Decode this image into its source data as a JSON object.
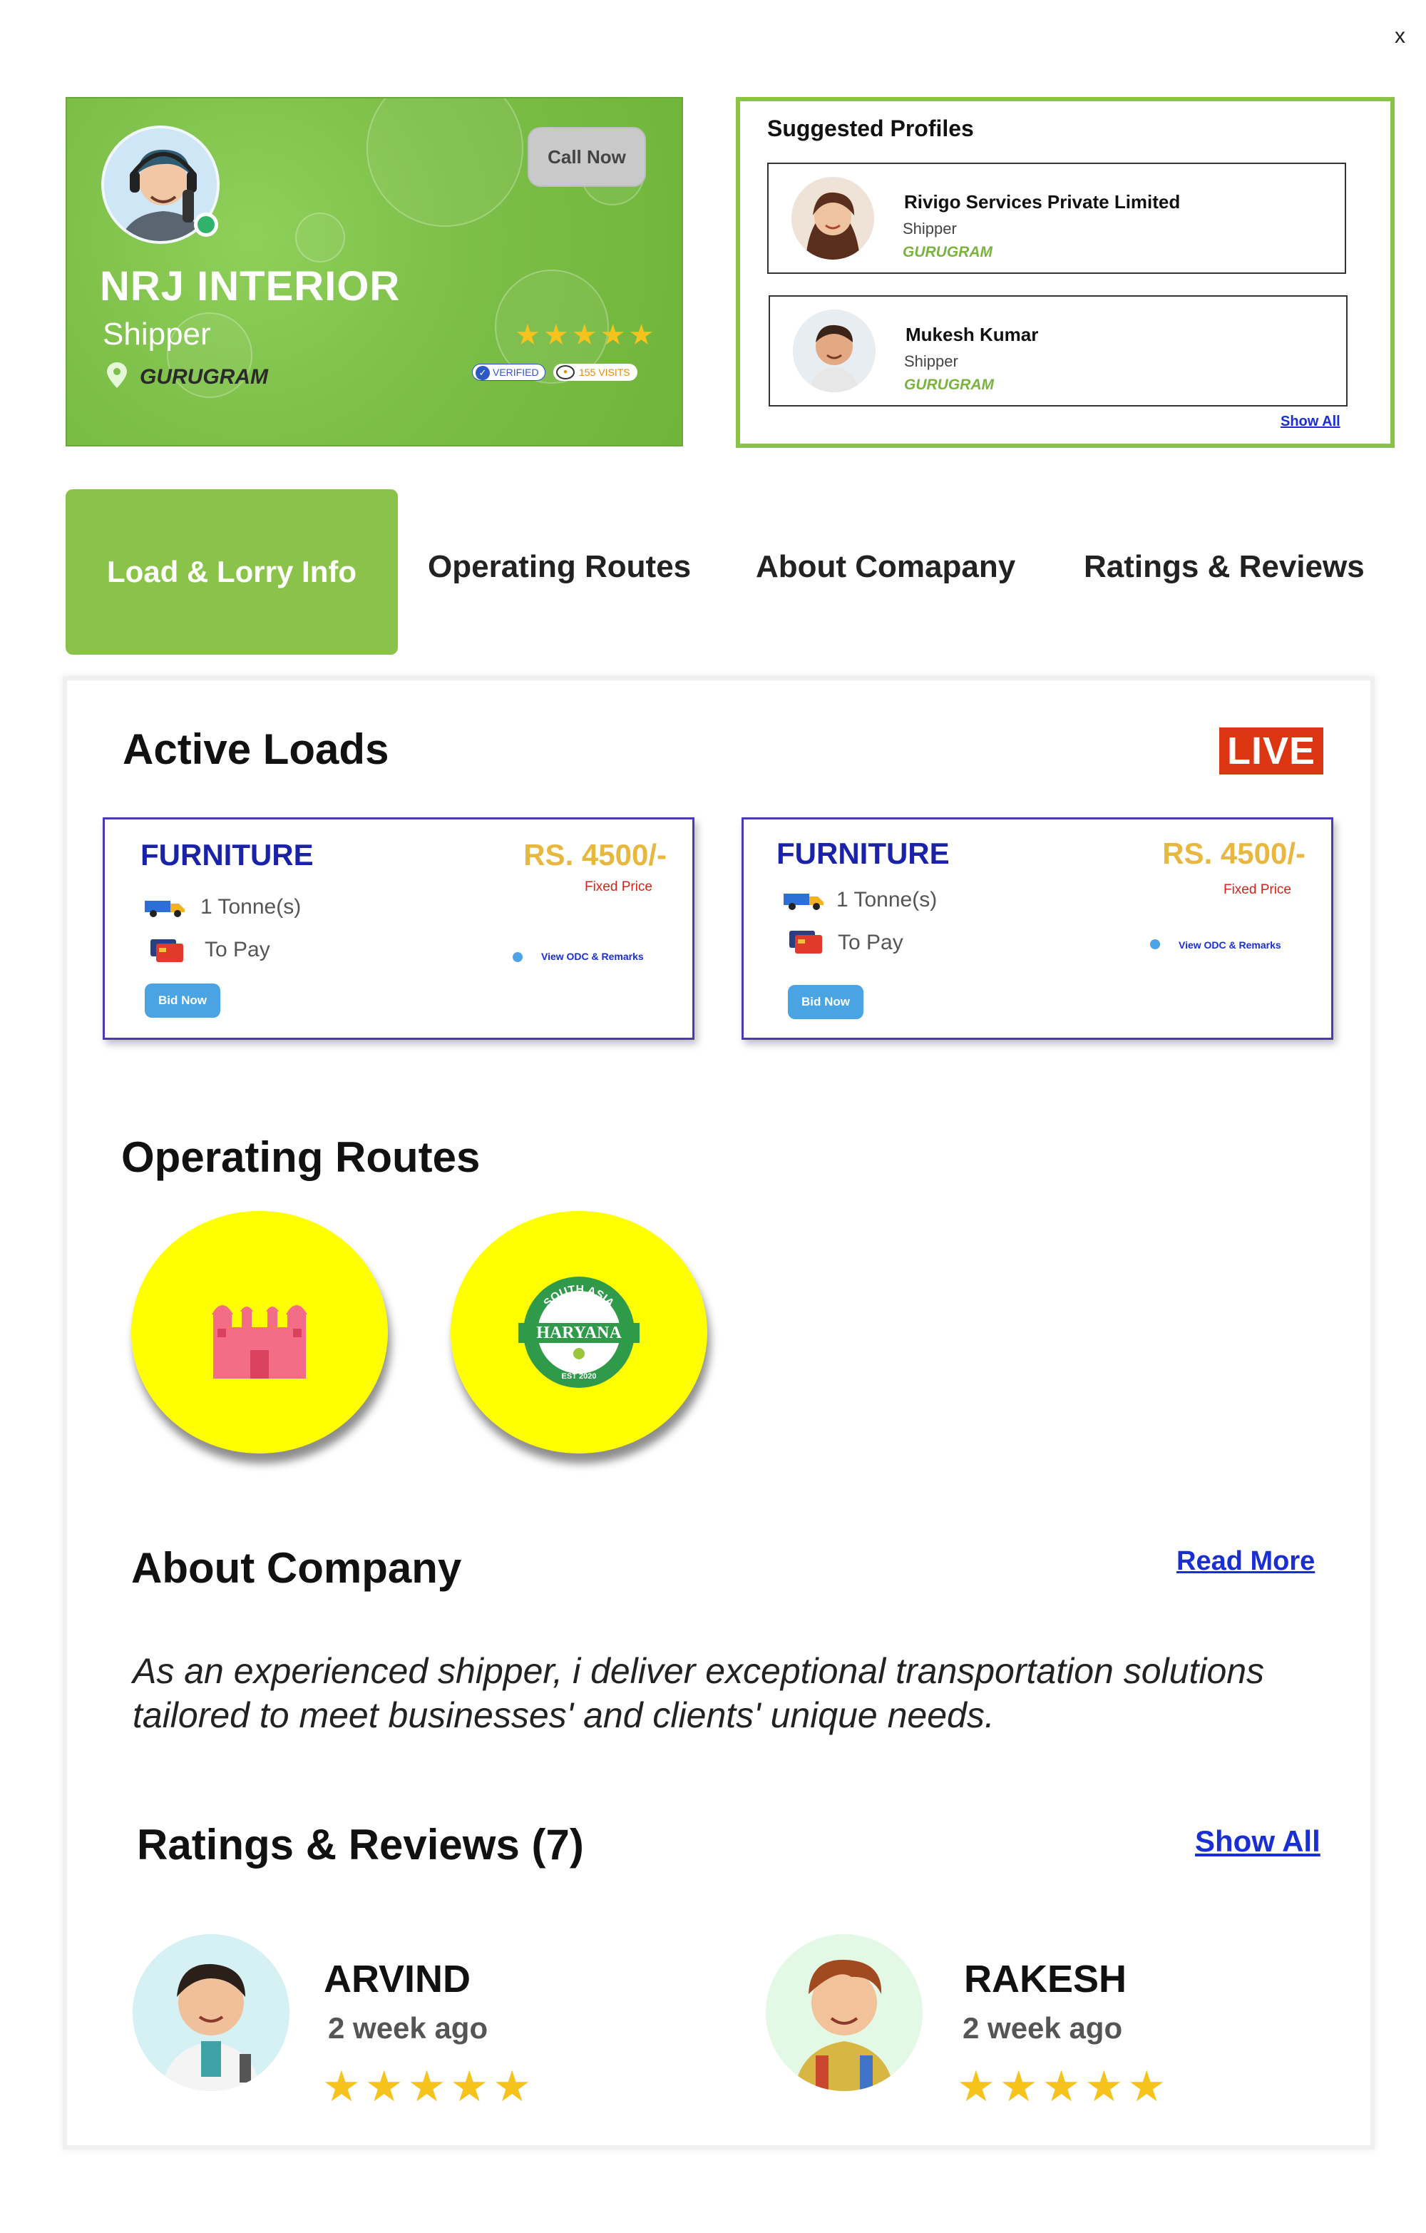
{
  "close_label": "x",
  "profile": {
    "name": "NRJ INTERIOR",
    "role": "Shipper",
    "city": "GURUGRAM",
    "call_label": "Call Now",
    "rating": 5,
    "verified_label": "VERIFIED",
    "visits_label": "155 VISITS"
  },
  "suggested": {
    "title": "Suggested Profiles",
    "items": [
      {
        "name": "Rivigo Services Private Limited",
        "role": "Shipper",
        "city": "GURUGRAM"
      },
      {
        "name": "Mukesh Kumar",
        "role": "Shipper",
        "city": "GURUGRAM"
      }
    ],
    "show_all": "Show All"
  },
  "tabs": [
    {
      "label": "Load & Lorry Info",
      "active": true
    },
    {
      "label": "Operating Routes",
      "active": false
    },
    {
      "label": "About Comapany",
      "active": false
    },
    {
      "label": "Ratings & Reviews",
      "active": false
    }
  ],
  "active_loads": {
    "title": "Active Loads",
    "live_label": "LIVE",
    "cards": [
      {
        "material": "FURNITURE",
        "price": "RS. 4500/-",
        "price_type": "Fixed Price",
        "weight": "1 Tonne(s)",
        "payment": "To Pay",
        "odc_link": "View ODC & Remarks",
        "bid_label": "Bid Now"
      },
      {
        "material": "FURNITURE",
        "price": "RS. 4500/-",
        "price_type": "Fixed Price",
        "weight": "1 Tonne(s)",
        "payment": "To Pay",
        "odc_link": "View ODC & Remarks",
        "bid_label": "Bid Now"
      }
    ]
  },
  "operating_routes": {
    "title": "Operating Routes",
    "routes": [
      {
        "icon": "red-fort-icon"
      },
      {
        "icon": "haryana-emblem-icon",
        "emblem_text": "HARYANA",
        "emblem_top": "SOUTH ASIA",
        "emblem_bottom": "EST 2020"
      }
    ]
  },
  "about": {
    "title": "About Company",
    "read_more": "Read More",
    "text": "As an experienced shipper, i deliver exceptional transportation solutions tailored to meet businesses' and clients' unique needs."
  },
  "reviews": {
    "title": "Ratings & Reviews (7)",
    "show_all": "Show All",
    "items": [
      {
        "name": "ARVIND",
        "time": "2 week ago",
        "rating": 5
      },
      {
        "name": "RAKESH",
        "time": "2 week ago",
        "rating": 5
      }
    ]
  },
  "colors": {
    "brand_green": "#8bc34a",
    "live_red": "#dc3512",
    "link_blue": "#1a2fd1",
    "price_gold": "#e8b740",
    "title_navy": "#1a22a8",
    "star_yellow": "#f6c21c"
  }
}
